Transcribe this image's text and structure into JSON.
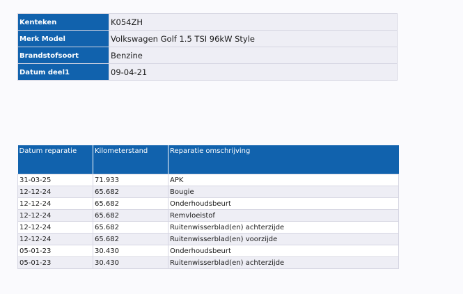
{
  "vehicle": {
    "rows": [
      {
        "label": "Kenteken",
        "value": "K054ZH"
      },
      {
        "label": "Merk Model",
        "value": "Volkswagen Golf 1.5 TSI 96kW Style"
      },
      {
        "label": "Brandstofsoort",
        "value": "Benzine"
      },
      {
        "label": "Datum deel1",
        "value": "09-04-21"
      }
    ]
  },
  "repairs": {
    "headers": [
      "Datum reparatie",
      "Kilometerstand",
      "Reparatie omschrijving"
    ],
    "rows": [
      {
        "date": "31-03-25",
        "km": "71.933",
        "description": "APK"
      },
      {
        "date": "12-12-24",
        "km": "65.682",
        "description": "Bougie"
      },
      {
        "date": "12-12-24",
        "km": "65.682",
        "description": "Onderhoudsbeurt"
      },
      {
        "date": "12-12-24",
        "km": "65.682",
        "description": "Remvloeistof"
      },
      {
        "date": "12-12-24",
        "km": "65.682",
        "description": "Ruitenwisserblad(en) achterzijde"
      },
      {
        "date": "12-12-24",
        "km": "65.682",
        "description": "Ruitenwisserblad(en) voorzijde"
      },
      {
        "date": "05-01-23",
        "km": "30.430",
        "description": "Onderhoudsbeurt"
      },
      {
        "date": "05-01-23",
        "km": "30.430",
        "description": "Ruitenwisserblad(en) achterzijde"
      }
    ]
  },
  "colors": {
    "header_blue": "#1162ad",
    "row_alt": "#eeeef5",
    "border": "#d6d6e2"
  }
}
